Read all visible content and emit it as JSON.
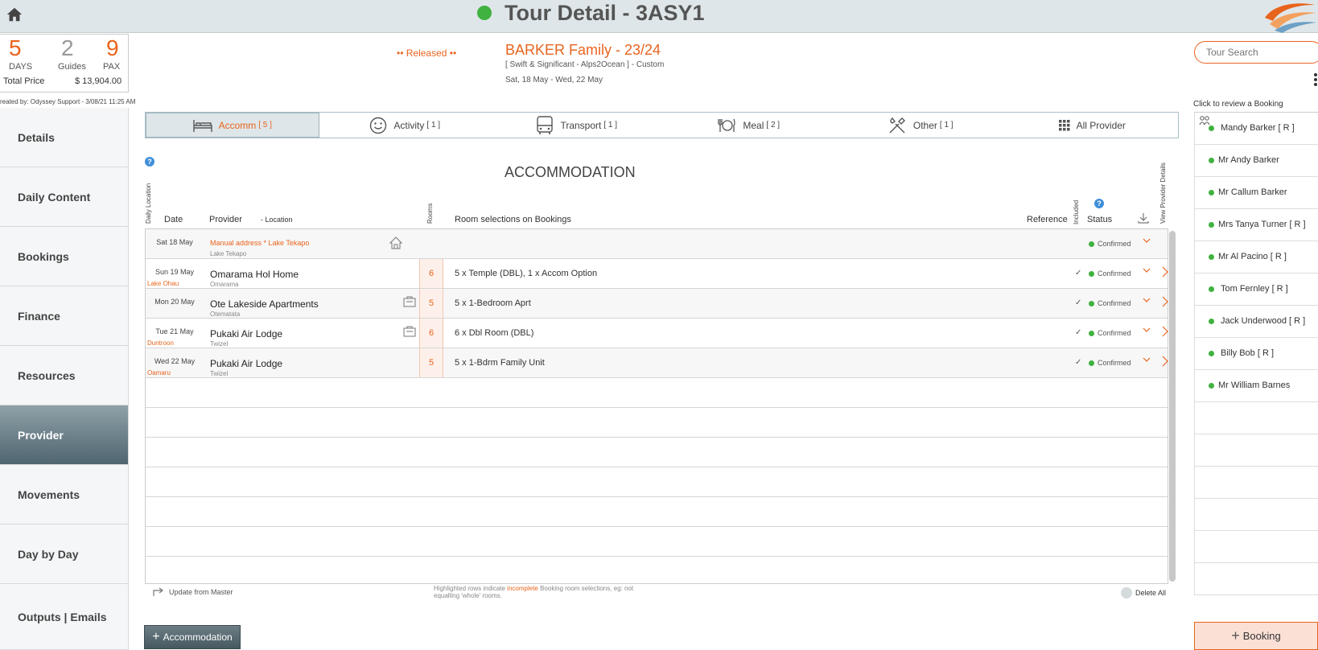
{
  "header": {
    "title": "Tour Detail - 3ASY1",
    "status_color": "#3fb23f"
  },
  "stats": {
    "days_value": "5",
    "days_label": "DAYS",
    "guides_value": "2",
    "guides_label": "Guides",
    "pax_value": "9",
    "pax_label": "PAX",
    "total_price_label": "Total Price",
    "total_price_value": "$ 13,904.00"
  },
  "created_by": "reated by: Odyssey Support - 3/08/21 11:25 AM",
  "tour": {
    "status": "•• Released ••",
    "name": "BARKER Family - 23/24",
    "subtitle": "[ Swift & Significant - Alps2Ocean ] - Custom",
    "dates": "Sat, 18 May  - Wed, 22 May"
  },
  "search": {
    "placeholder": "Tour Search"
  },
  "sidebar": {
    "items": [
      {
        "label": "Details"
      },
      {
        "label": "Daily Content"
      },
      {
        "label": "Bookings"
      },
      {
        "label": "Finance"
      },
      {
        "label": "Resources"
      },
      {
        "label": "Provider",
        "active": true
      },
      {
        "label": "Movements"
      },
      {
        "label": "Day by Day"
      },
      {
        "label": "Outputs | Emails"
      }
    ]
  },
  "tabs": [
    {
      "label": "Accomm",
      "count": "[ 5 ]",
      "icon": "bed-icon",
      "active": true
    },
    {
      "label": "Activity",
      "count": "[ 1 ]",
      "icon": "smiley-icon"
    },
    {
      "label": "Transport",
      "count": "[ 1 ]",
      "icon": "bus-icon"
    },
    {
      "label": "Meal",
      "count": "[ 2 ]",
      "icon": "meal-icon"
    },
    {
      "label": "Other",
      "count": "[ 1 ]",
      "icon": "tools-icon"
    },
    {
      "label": "All Provider",
      "count": "",
      "icon": "grid-icon"
    }
  ],
  "section_title": "ACCOMMODATION",
  "columns": {
    "daily_location": "Daily Location",
    "date": "Date",
    "provider": "Provider",
    "location": "-  Location",
    "rooms": "Rooms",
    "room_selections": "Room selections on Bookings",
    "reference": "Reference",
    "included": "Included",
    "status": "Status",
    "view_provider": "View Provider Details"
  },
  "rows": [
    {
      "date": "Sat 18 May",
      "daily_loc": "",
      "provider": "Manual address * Lake Tekapo",
      "location": "Lake Tekapo",
      "rooms": "",
      "selection": "",
      "included": false,
      "status": "Confirmed",
      "manual": true
    },
    {
      "date": "Sun 19 May",
      "daily_loc": "Lake Ohau",
      "provider": "Omarama Hol Home",
      "location": "Omarama",
      "rooms": "6",
      "selection": "5 x Temple (DBL), 1 x Accom Option",
      "included": true,
      "status": "Confirmed"
    },
    {
      "date": "Mon 20 May",
      "daily_loc": "",
      "provider": "Ote Lakeside Apartments",
      "location": "Otematata",
      "rooms": "5",
      "selection": "5 x 1-Bedroom Aprt",
      "included": true,
      "status": "Confirmed"
    },
    {
      "date": "Tue 21 May",
      "daily_loc": "Duntroon",
      "provider": "Pukaki Air Lodge",
      "location": "Twizel",
      "rooms": "6",
      "selection": "6 x Dbl Room (DBL)",
      "included": true,
      "status": "Confirmed"
    },
    {
      "date": "Wed 22 May",
      "daily_loc": "Oamaru",
      "provider": "Pukaki Air Lodge",
      "location": "Twizel",
      "rooms": "5",
      "selection": "5 x 1-Bdrm Family Unit",
      "included": true,
      "status": "Confirmed"
    }
  ],
  "footer": {
    "update_label": "Update from Master",
    "note_prefix": "Highlighted rows indicate ",
    "note_highlight": "incomplete",
    "note_suffix": " Booking room selections, eg: not equalling 'whole' rooms.",
    "delete_all": "Delete All",
    "add_button": "Accommodation"
  },
  "right_panel": {
    "hint": "Click to review a Booking",
    "bookings": [
      "Mandy Barker  [ R ]",
      "Mr Andy Barker",
      "Mr Callum Barker",
      "Mrs Tanya Turner  [ R ]",
      "Mr Al Pacino  [ R ]",
      "Tom Fernley  [ R ]",
      "Jack Underwood  [ R ]",
      "Billy Bob  [ R ]",
      "Mr William Barnes"
    ],
    "add_button": "Booking"
  },
  "colors": {
    "accent": "#e8641e",
    "status_green": "#3fb23f",
    "dark_button": "#4f6570"
  }
}
